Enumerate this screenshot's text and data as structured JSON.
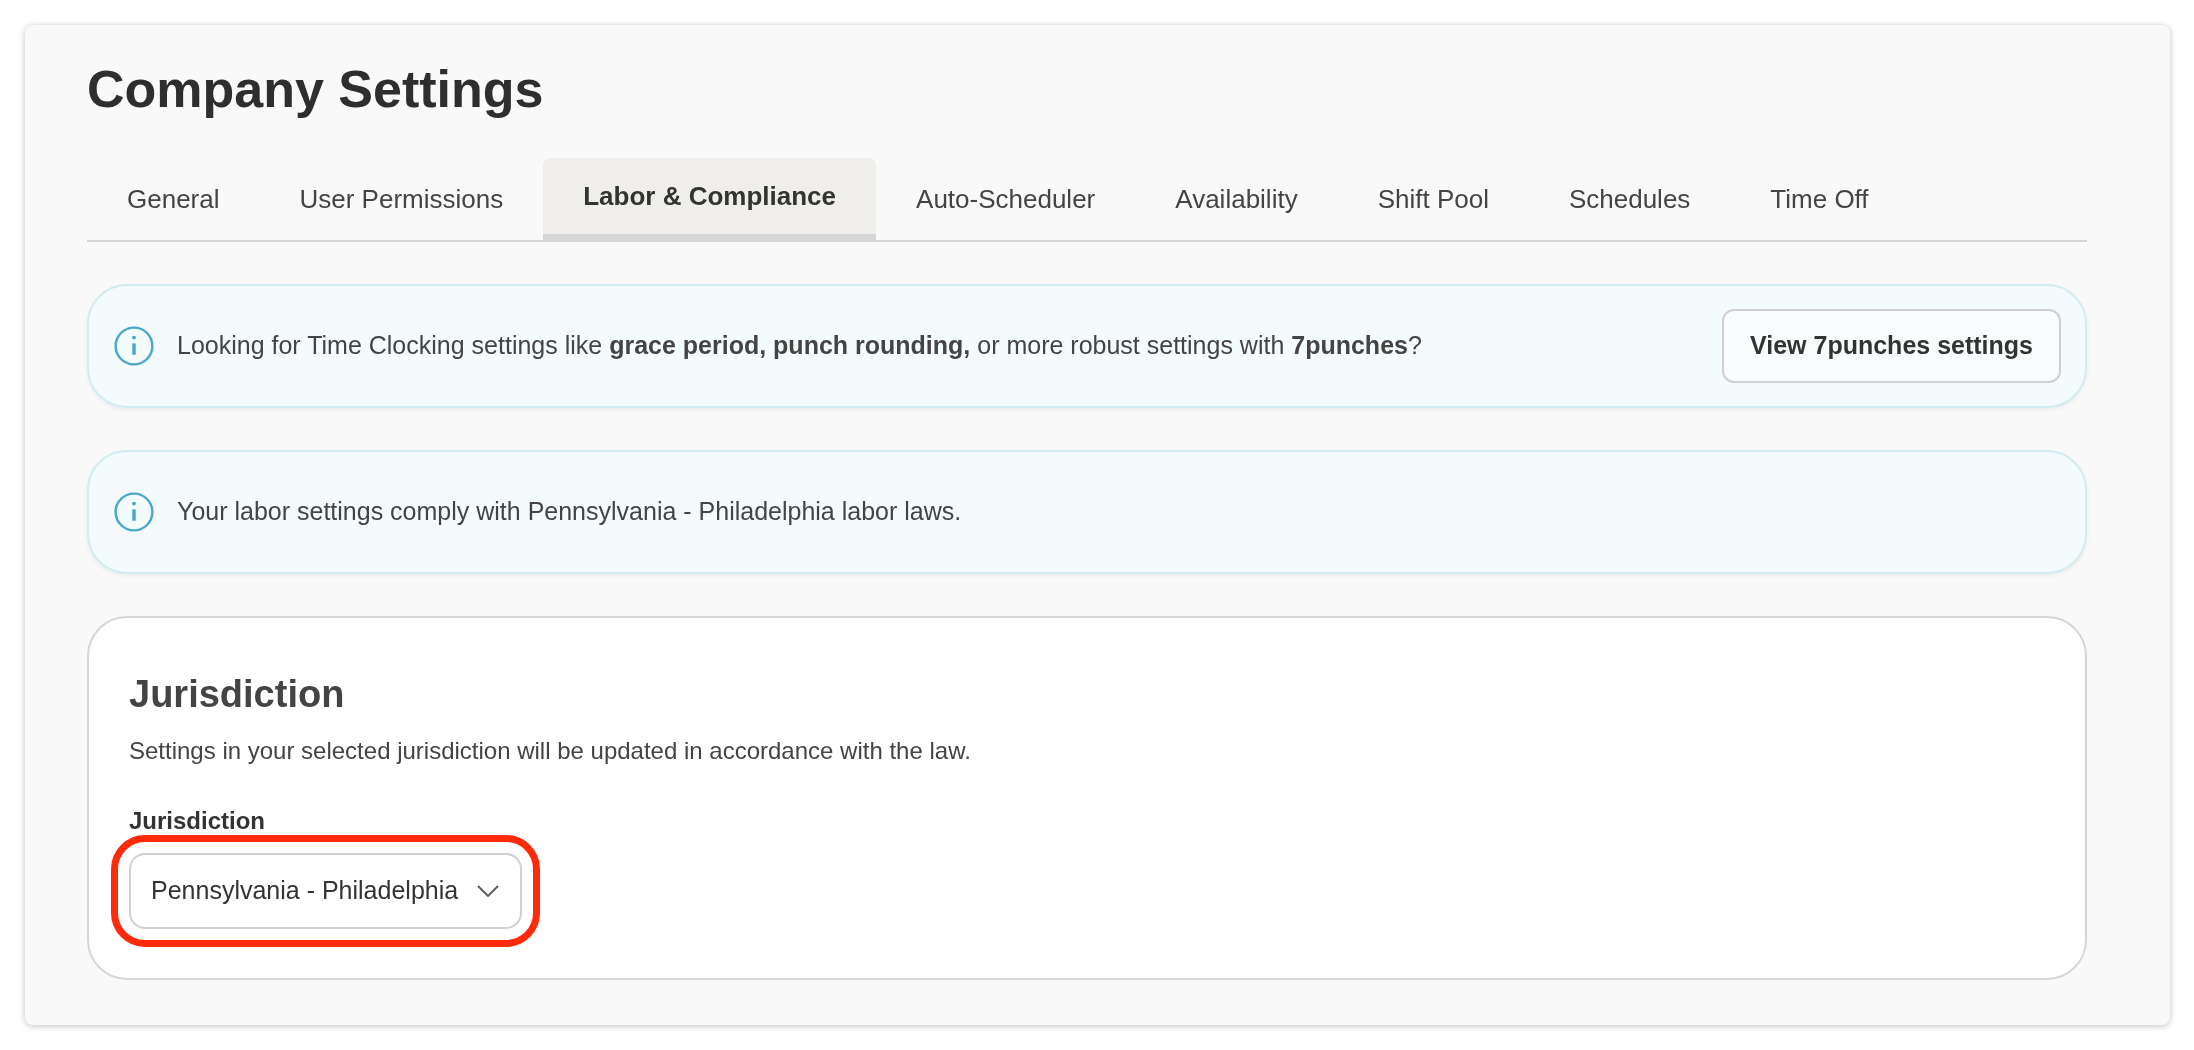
{
  "page": {
    "title": "Company Settings"
  },
  "tabs": [
    {
      "label": "General",
      "selected": false
    },
    {
      "label": "User Permissions",
      "selected": false
    },
    {
      "label": "Labor & Compliance",
      "selected": true
    },
    {
      "label": "Auto-Scheduler",
      "selected": false
    },
    {
      "label": "Availability",
      "selected": false
    },
    {
      "label": "Shift Pool",
      "selected": false
    },
    {
      "label": "Schedules",
      "selected": false
    },
    {
      "label": "Time Off",
      "selected": false
    }
  ],
  "banners": [
    {
      "text": "Looking for Time Clocking settings like **grace period, punch rounding,** or more robust settings with **7punches**?",
      "button": "View 7punches settings"
    },
    {
      "text": "Your labor settings comply with Pennsylvania - Philadelphia labor laws."
    }
  ],
  "jurisdiction_card": {
    "title": "Jurisdiction",
    "description": "Settings in your selected jurisdiction will be updated in accordance with the law.",
    "field_label": "Jurisdiction",
    "value": "Pennsylvania - Philadelphia",
    "highlighted": true
  }
}
